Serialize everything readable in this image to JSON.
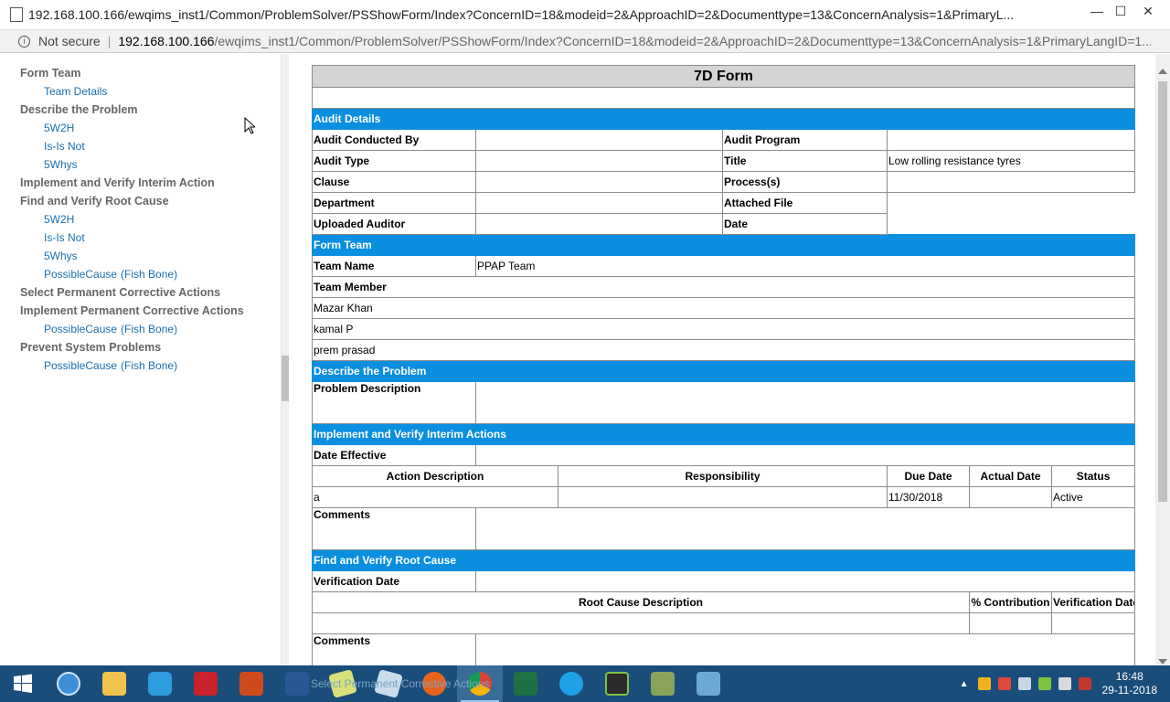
{
  "window": {
    "title": "192.168.100.166/ewqims_inst1/Common/ProblemSolver/PSShowForm/Index?ConcernID=18&modeid=2&ApproachID=2&Documenttype=13&ConcernAnalysis=1&PrimaryL...",
    "minimize": "—",
    "maximize": "☐",
    "close": "✕"
  },
  "address": {
    "not_secure": "Not secure",
    "separator": "|",
    "host": "192.168.100.166",
    "path": "/ewqims_inst1/Common/ProblemSolver/PSShowForm/Index?ConcernID=18&modeid=2&ApproachID=2&Documenttype=13&ConcernAnalysis=1&PrimaryLangID=1..."
  },
  "sidebar": {
    "form_team": "Form Team",
    "team_details": "Team Details",
    "describe": "Describe the Problem",
    "d_5w2h": "5W2H",
    "d_isisnot": "Is-Is Not",
    "d_5whys": "5Whys",
    "interim": "Implement and Verify Interim Action",
    "root": "Find and Verify Root Cause",
    "r_5w2h": "5W2H",
    "r_isisnot": "Is-Is Not",
    "r_5whys": "5Whys",
    "r_possible": "PossibleCause",
    "r_fishbone": "(Fish Bone)",
    "select_perm": "Select Permanent Corrective Actions",
    "impl_perm": "Implement Permanent Corrective Actions",
    "ip_possible": "PossibleCause",
    "ip_fishbone": "(Fish Bone)",
    "prevent": "Prevent System Problems",
    "pv_possible": "PossibleCause",
    "pv_fishbone": "(Fish Bone)"
  },
  "form": {
    "title": "7D Form",
    "audit": {
      "header": "Audit Details",
      "conducted_by": "Audit Conducted By",
      "program": "Audit Program",
      "type": "Audit Type",
      "title_label": "Title",
      "title_value": "Low rolling resistance tyres",
      "clause": "Clause",
      "process": "Process(s)",
      "department": "Department",
      "attached": "Attached File",
      "uploaded": "Uploaded Auditor",
      "date": "Date"
    },
    "team": {
      "header": "Form Team",
      "name_label": "Team Name",
      "name_value": "PPAP Team",
      "member_label": "Team Member",
      "members": [
        "Mazar Khan",
        "kamal P",
        "prem prasad"
      ]
    },
    "problem": {
      "header": "Describe the Problem",
      "desc_label": "Problem Description"
    },
    "interim": {
      "header": "Implement and Verify Interim Actions",
      "date_effective": "Date Effective",
      "cols": [
        "Action Description",
        "Responsibility",
        "Due Date",
        "Actual Date",
        "Status"
      ],
      "row": [
        "a",
        "",
        "11/30/2018",
        "",
        "Active"
      ],
      "comments": "Comments"
    },
    "root": {
      "header": "Find and Verify Root Cause",
      "verification_date": "Verification Date",
      "cols": [
        "Root Cause Description",
        "% Contribution",
        "Verification Date"
      ],
      "comments": "Comments"
    }
  },
  "taskbar": {
    "ghost_text": "Select Permanent Corrective Actions",
    "time": "16:48",
    "date": "29-11-2018"
  },
  "colors": {
    "section_header": "#0a8fe0",
    "title_bg": "#d4d4d4",
    "link": "#1a6faf",
    "taskbar": "#1b4d7a"
  }
}
